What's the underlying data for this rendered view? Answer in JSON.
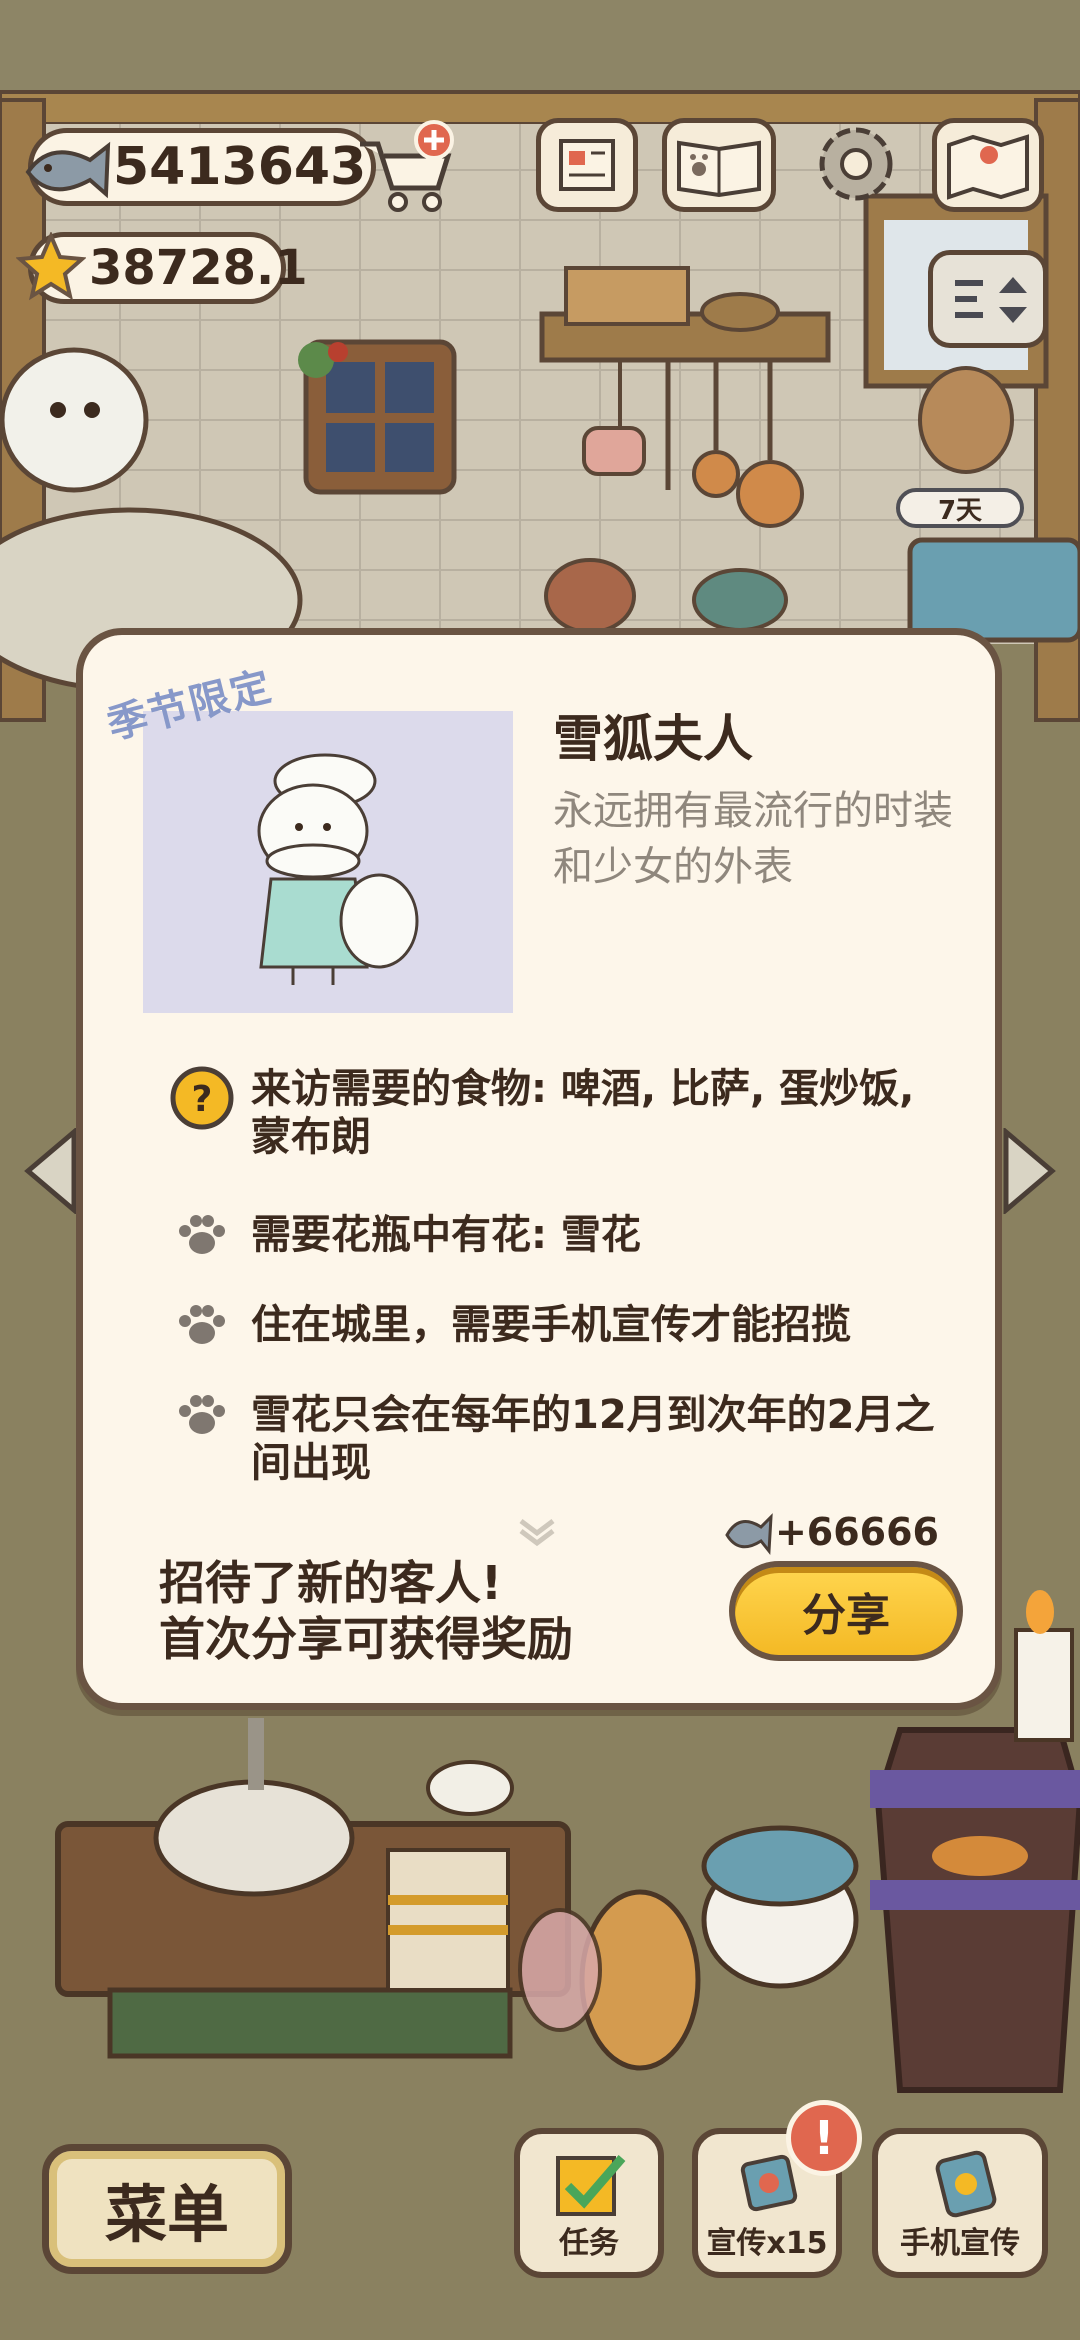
{
  "hud": {
    "fish_count": "5413643",
    "star_count": "38728.1",
    "days_badge": "7天"
  },
  "modal": {
    "season_tag": "季节限定",
    "guest_name": "雪狐夫人",
    "guest_desc": "永远拥有最流行的时装和少女的外表",
    "requirements": [
      {
        "icon": "question-icon",
        "text": "来访需要的食物: 啤酒, 比萨, 蛋炒饭, 蒙布朗"
      },
      {
        "icon": "paw-icon",
        "text": "需要花瓶中有花: 雪花"
      },
      {
        "icon": "paw-icon",
        "text": "住在城里，需要手机宣传才能招揽"
      },
      {
        "icon": "paw-icon",
        "text": "雪花只会在每年的12月到次年的2月之间出现"
      }
    ],
    "reward": "+66666",
    "share_message_line1": "招待了新的客人!",
    "share_message_line2": "首次分享可获得奖励",
    "share_button": "分享"
  },
  "bottom": {
    "menu_label": "菜单",
    "tasks_label": "任务",
    "promote_label": "宣传x15",
    "phone_promote_label": "手机宣传",
    "badge": "!"
  },
  "colors": {
    "modal_bg": "#fdf6ea",
    "outline": "#6a5443",
    "share_button": "#f4b925",
    "season_tag": "#8798c9",
    "badge": "#e0674f"
  }
}
